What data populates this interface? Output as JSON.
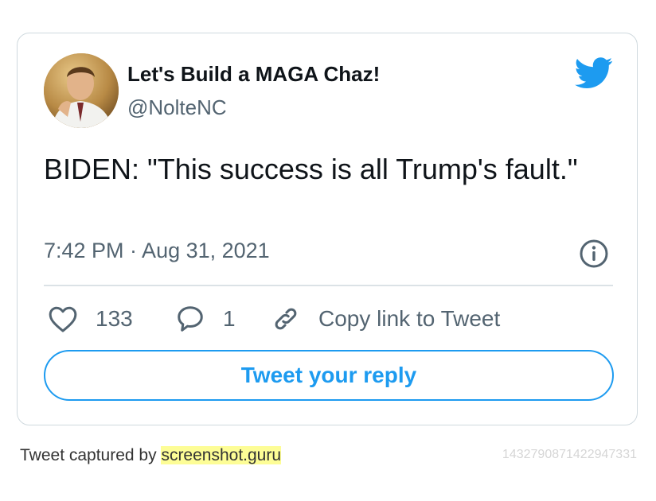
{
  "tweet": {
    "author": {
      "display_name": "Let's Build a MAGA Chaz!",
      "handle": "@NolteNC",
      "avatar": "author-avatar-photo"
    },
    "text": "BIDEN: \"This success is all Trump's fault.\"",
    "timestamp": "7:42 PM · Aug 31, 2021",
    "actions": {
      "likes_icon": "heart-icon",
      "likes_count": "133",
      "replies_icon": "speech-bubble-icon",
      "replies_count": "1",
      "copy_icon": "link-icon",
      "copy_link_label": "Copy link to Tweet"
    },
    "reply_button_label": "Tweet your reply",
    "brand_icon": "twitter-bird-icon",
    "info_icon": "info-icon"
  },
  "footer": {
    "captured_prefix": "Tweet captured by ",
    "captured_site": "screenshot.guru",
    "tweet_id": "1432790871422947331"
  },
  "colors": {
    "accent": "#1d9bf0",
    "text_primary": "#0f1419",
    "text_secondary": "#536471",
    "border": "#cfd9de",
    "highlight": "#fdfd96"
  }
}
